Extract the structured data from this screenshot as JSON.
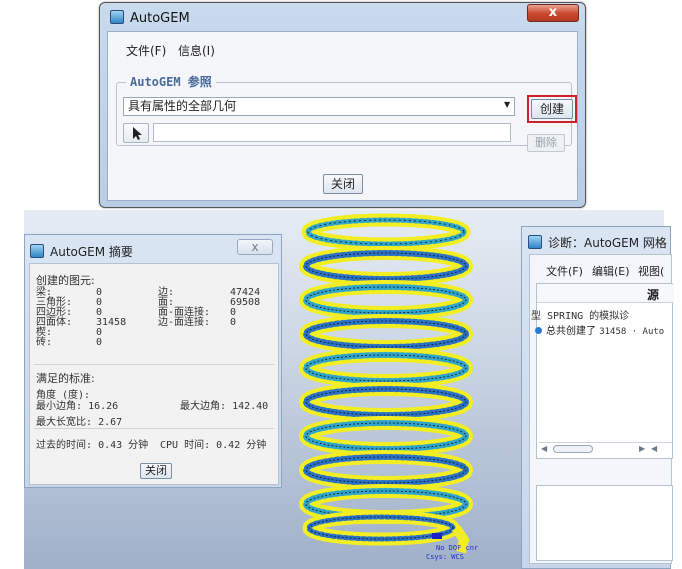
{
  "top_dialog": {
    "title": "AutoGEM",
    "close_glyph": "x",
    "menu": [
      "文件(F)",
      "信息(I)"
    ],
    "group_title": "AutoGEM 参照",
    "select_value": "具有属性的全部几何",
    "create_label": "创建",
    "delete_label": "删除",
    "close_label": "关闭",
    "highlight_color": "#d0202a"
  },
  "summary": {
    "title": "AutoGEM 摘要",
    "close_glyph": "x",
    "created_header": "创建的图元:",
    "left_items": [
      {
        "label": "梁:",
        "value": "0"
      },
      {
        "label": "三角形:",
        "value": "0"
      },
      {
        "label": "四边形:",
        "value": "0"
      },
      {
        "label": "四面体:",
        "value": "31458"
      },
      {
        "label": "楔:",
        "value": "0"
      },
      {
        "label": "砖:",
        "value": "0"
      }
    ],
    "right_items": [
      {
        "label": "边:",
        "value": "47424"
      },
      {
        "label": "面:",
        "value": "69508"
      },
      {
        "label": "面-面连接:",
        "value": "0"
      },
      {
        "label": "边-面连接:",
        "value": "0"
      }
    ],
    "criteria_header": "满足的标准:",
    "angle_header": "角度 (度):",
    "min_edge_angle_label": "最小边角:",
    "min_edge_angle": "16.26",
    "max_edge_angle_label": "最大边角:",
    "max_edge_angle": "142.40",
    "max_aspect_label": "最大长宽比:",
    "max_aspect": "2.67",
    "elapsed_label": "过去的时间:",
    "elapsed": "0.43 分钟",
    "cpu_label": "CPU 时间:",
    "cpu": "0.42 分钟",
    "close_label": "关闭"
  },
  "diagnostics": {
    "title": "诊断：AutoGEM 网格",
    "menu": [
      "文件(F)",
      "编辑(E)",
      "视图("
    ],
    "column_header": "源",
    "line1": "型 SPRING 的模拟诊",
    "line2_prefix": "总共创建了",
    "line2_mono": "31458 · Auto"
  },
  "viewport": {
    "triad_line1": "No DOF cnr",
    "triad_line2": "Csys: WCS"
  }
}
